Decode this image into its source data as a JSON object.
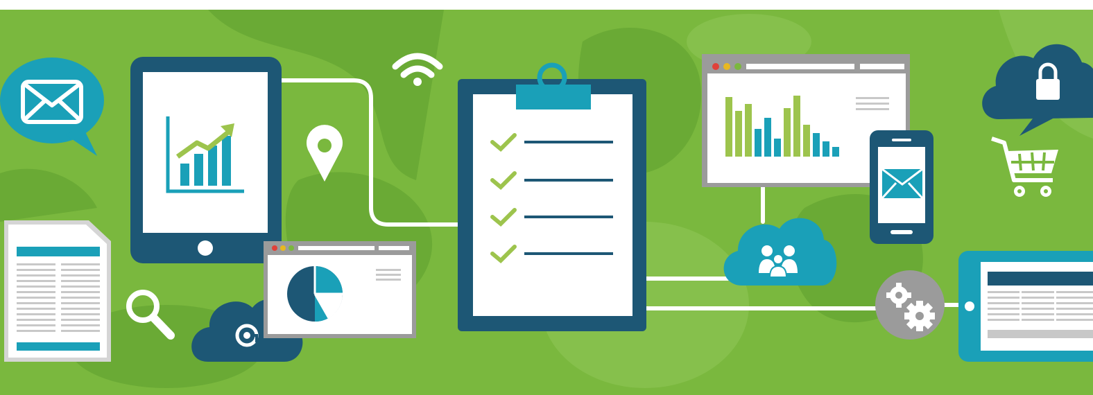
{
  "banner": {
    "colors": {
      "background": "#7ab83e",
      "background_blob": "#6aaa35",
      "background_blob_light": "#86c04c",
      "navy": "#1d5775",
      "teal": "#1aa0b8",
      "accent_green": "#9dc44d",
      "white": "#ffffff",
      "gray": "#9b9b9b",
      "light_gray": "#d5d5d5",
      "red_dot": "#e0413a",
      "yellow_dot": "#e8b820",
      "green_dot": "#7bb83e"
    },
    "icons": [
      "email-bubble-icon",
      "tablet-growth-chart-icon",
      "wifi-icon",
      "location-pin-icon",
      "clipboard-checklist-icon",
      "browser-bar-chart-icon",
      "cloud-lock-icon",
      "shopping-cart-icon",
      "smartphone-email-icon",
      "cloud-people-icon",
      "gear-icon",
      "tablet-table-icon",
      "document-icon",
      "search-icon",
      "cloud-at-icon",
      "browser-pie-chart-icon"
    ]
  }
}
